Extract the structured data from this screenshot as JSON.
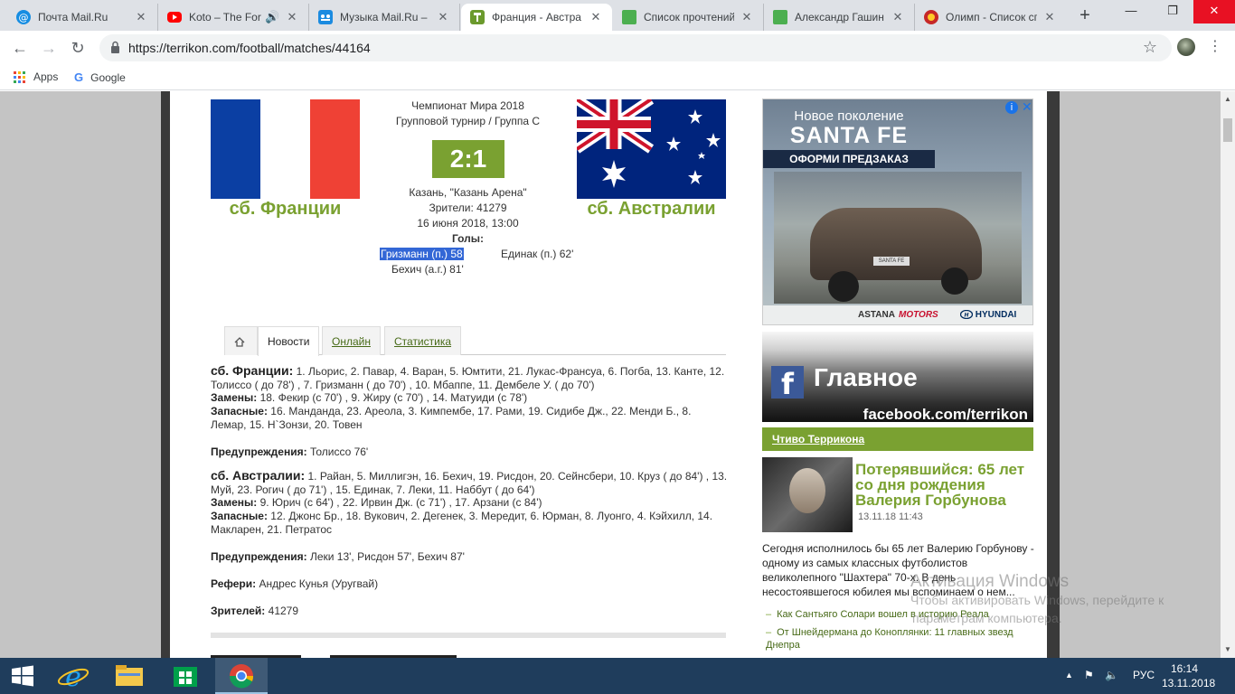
{
  "browser": {
    "tabs": [
      {
        "title": "Почта Mail.Ru",
        "icon": "at-icon",
        "color": "#168de2"
      },
      {
        "title": "Koto – The For",
        "icon": "youtube-icon",
        "color": "#ff0000"
      },
      {
        "title": "Музыка Mail.Ru – с",
        "icon": "music-icon",
        "color": "#1b8be0"
      },
      {
        "title": "Франция - Австра",
        "icon": "terrikon-icon",
        "color": "#6b9a2d"
      },
      {
        "title": "Список прочтений",
        "icon": "sheet-icon",
        "color": "#4caf50"
      },
      {
        "title": "Александр Гашин",
        "icon": "sheet-icon",
        "color": "#4caf50"
      },
      {
        "title": "Олимп - Список сп",
        "icon": "olimp-icon",
        "color": "#c62828"
      }
    ],
    "new_tab": "+",
    "window_controls": {
      "minimize": "—",
      "maximize": "❐",
      "close": "✕"
    },
    "url": "https://terrikon.com/football/matches/44164",
    "bookmarks": {
      "apps": "Apps",
      "google": "Google"
    }
  },
  "match": {
    "tournament": "Чемпионат Мира 2018",
    "stage": "Групповой турнир / Группа C",
    "score": "2:1",
    "venue": "Казань, \"Казань Арена\"",
    "attendance_line": "Зрители: 41279",
    "datetime": "16 июня 2018, 13:00",
    "goals_label": "Голы:",
    "home": {
      "name": "сб. Франции",
      "goals": [
        "Гризманн (п.) 58",
        "Бехич (а.г.) 81'"
      ]
    },
    "away": {
      "name": "сб. Австралии",
      "goals": [
        "Единак (п.) 62'"
      ]
    }
  },
  "content_tabs": [
    {
      "label": "Новости"
    },
    {
      "label": "Онлайн"
    },
    {
      "label": "Статистика"
    }
  ],
  "lineups": {
    "home": {
      "team": "сб. Франции:",
      "players": "1. Льорис, 2. Павар, 4. Варан, 5. Юмтити, 21. Лукас-Франсуа, 6. Погба, 13. Канте, 12. Толиссо ( до 78') , 7. Гризманн ( до 70') , 10. Мбаппе, 11. Дембеле У. ( до 70')",
      "subs_label": "Замены:",
      "subs": "18. Фекир (с 70') , 9. Жиру (с 70') , 14. Матуиди (с 78')",
      "reserve_label": "Запасные:",
      "reserve": "16. Манданда, 23. Ареола, 3. Кимпембе, 17. Рами, 19. Сидибе Дж., 22. Менди Б., 8. Лемар, 15. Н`Зонзи, 20. Товен",
      "warn_label": "Предупреждения:",
      "warnings": "Толиссо 76'"
    },
    "away": {
      "team": "сб. Австралии:",
      "players": "1. Райан, 5. Миллигэн, 16. Бехич, 19. Рисдон, 20. Сейнсбери, 10. Круз ( до 84') , 13. Муй, 23. Рогич ( до 71') , 15. Единак, 7. Леки, 11. Наббут ( до 64')",
      "subs_label": "Замены:",
      "subs": "9. Юрич (с 64') , 22. Ирвин Дж. (с 71') , 17. Арзани (с 84')",
      "reserve_label": "Запасные:",
      "reserve": "12. Джонс Бр., 18. Вукович, 2. Дегенек, 3. Мередит, 6. Юрман, 8. Луонго, 4. Кэйхилл, 14. Макларен, 21. Петратос",
      "warn_label": "Предупреждения:",
      "warnings": "Леки 13', Рисдон 57', Бехич 87'"
    },
    "referee_label": "Рефери:",
    "referee": "Андрес Кунья (Уругвай)",
    "viewers_label": "Зрителей:",
    "viewers": "41279"
  },
  "sidebar": {
    "ad": {
      "line1": "Новое поколение",
      "line2": "SANTA FE",
      "line3": "ОФОРМИ ПРЕДЗАКАЗ",
      "dealer_a": "ASTANA",
      "dealer_b": "MOTORS",
      "brand": "HYUNDAI",
      "plate": "SANTA FE",
      "info": "i",
      "close": "✕"
    },
    "fb": {
      "title": "Главное",
      "url": "facebook.com/terrikon",
      "icon_letter": "f"
    },
    "section_title": "Чтиво Терриконa",
    "news": {
      "title": "Потерявшийся: 65 лет со дня рождения Валерия Горбунова",
      "date": "13.11.18 11:43",
      "text": "Сегодня исполнилось бы 65 лет Валерию Горбунову - одному из самых классных футболистов великолепного \"Шахтера\" 70-х. В день несостоявшегося юбилея мы вспоминаем о нем...",
      "related": [
        "Как Сантьяго Солари вошел в историю Реала",
        "От Шнейдермана до Коноплянки: 11 главных звезд Днепра"
      ]
    }
  },
  "watermark": {
    "line1": "Активация Windows",
    "line2": "Чтобы активировать Windows, перейдите к",
    "line3": "параметрам компьютера."
  },
  "taskbar": {
    "language": "РУС",
    "time": "16:14",
    "date": "13.11.2018"
  },
  "colors": {
    "accent_green": "#7aa131",
    "selection_blue": "#3367d6"
  }
}
